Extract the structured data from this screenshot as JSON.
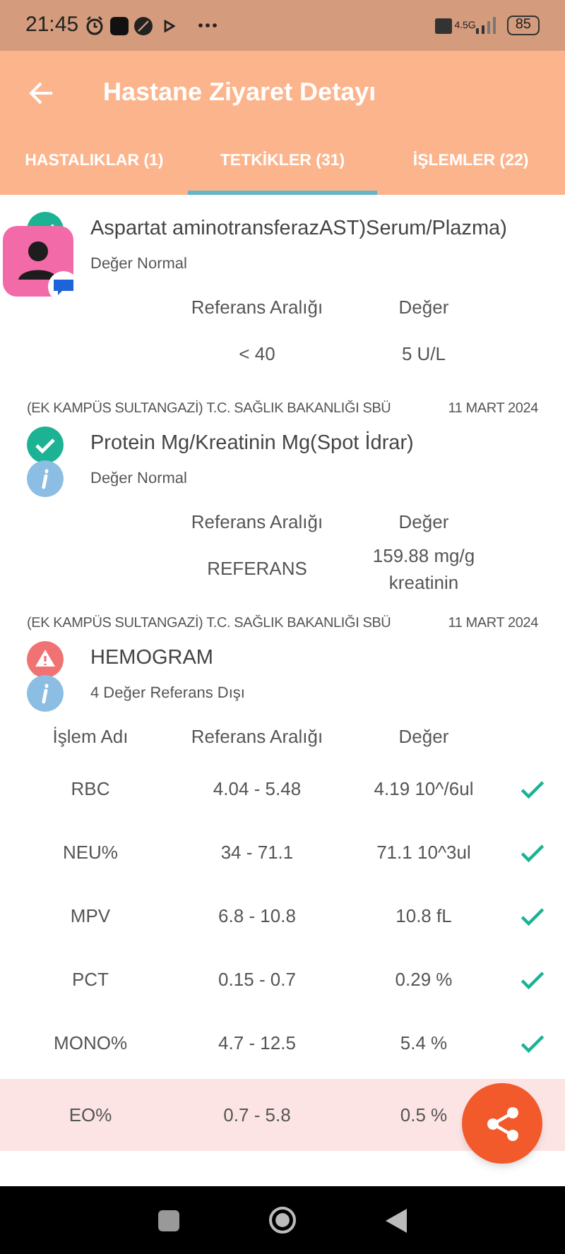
{
  "status_bar": {
    "time": "21:45",
    "battery": "85",
    "network": "4.5G"
  },
  "app_bar": {
    "title": "Hastane Ziyaret Detayı"
  },
  "tabs": [
    {
      "label": "HASTALIKLAR (1)",
      "selected": false
    },
    {
      "label": "TETKİKLER (31)",
      "selected": true
    },
    {
      "label": "İŞLEMLER (22)",
      "selected": false
    }
  ],
  "results": [
    {
      "kind": "normal",
      "name": "Aspartat aminotransferazAST)Serum/Plazma)",
      "note": "Değer Normal",
      "table": {
        "columns": [
          "Referans Aralığı",
          "Değer"
        ],
        "rows": [
          {
            "cells": [
              "< 40",
              "5 U/L"
            ]
          }
        ]
      }
    },
    {
      "hospital": "(EK KAMPÜS SULTANGAZİ) T.C. SAĞLIK BAKANLIĞI SBÜ",
      "date": "11 MART 2024",
      "kind": "normal",
      "name": "Protein Mg/Kreatinin Mg(Spot İdrar)",
      "note": "Değer Normal",
      "table": {
        "columns": [
          "Referans Aralığı",
          "Değer"
        ],
        "rows": [
          {
            "cells": [
              "REFERANS",
              "159.88 mg/g kreatinin"
            ]
          }
        ]
      }
    },
    {
      "hospital": "(EK KAMPÜS SULTANGAZİ) T.C. SAĞLIK BAKANLIĞI SBÜ",
      "date": "11 MART 2024",
      "kind": "abnormal",
      "name": "HEMOGRAM",
      "note": "4 Değer Referans Dışı",
      "table": {
        "columns": [
          "İşlem Adı",
          "Referans Aralığı",
          "Değer"
        ],
        "rows": [
          {
            "cells": [
              "RBC",
              "4.04 - 5.48",
              "4.19 10^/6ul"
            ],
            "in_range": true
          },
          {
            "cells": [
              "NEU%",
              "34 - 71.1",
              "71.1 10^3ul"
            ],
            "in_range": true
          },
          {
            "cells": [
              "MPV",
              "6.8 - 10.8",
              "10.8 fL"
            ],
            "in_range": true
          },
          {
            "cells": [
              "PCT",
              "0.15 - 0.7",
              "0.29 %"
            ],
            "in_range": true
          },
          {
            "cells": [
              "MONO%",
              "4.7 - 12.5",
              "5.4 %"
            ],
            "in_range": true
          },
          {
            "cells": [
              "EO%",
              "0.7 - 5.8",
              "0.5 %"
            ],
            "in_range": false
          }
        ]
      }
    }
  ]
}
